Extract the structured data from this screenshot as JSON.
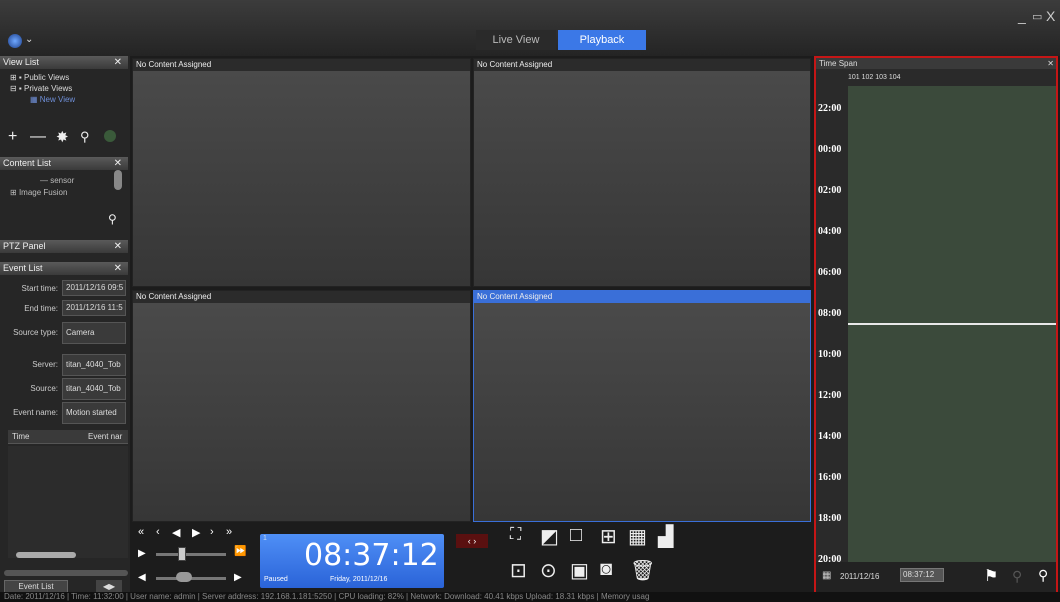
{
  "window": {
    "minimize": "_",
    "restore": "▭",
    "close": "X"
  },
  "tabs": {
    "live": "Live View",
    "playback": "Playback"
  },
  "view_list": {
    "title": "View List",
    "items": [
      "Public Views",
      "Private Views",
      "New View"
    ]
  },
  "content_list": {
    "title": "Content List",
    "items": [
      "sensor",
      "Image Fusion"
    ]
  },
  "ptz_panel": {
    "title": "PTZ Panel"
  },
  "event_list": {
    "title": "Event List",
    "start_label": "Start time:",
    "start_value": "2011/12/16 09:5",
    "end_label": "End time:",
    "end_value": "2011/12/16 11:5",
    "source_type_label": "Source type:",
    "source_type_value": "Camera",
    "server_label": "Server:",
    "server_value": "titan_4040_Tob",
    "source_label": "Source:",
    "source_value": "titan_4040_Tob",
    "event_name_label": "Event name:",
    "event_name_value": "Motion started",
    "col_time": "Time",
    "col_event": "Event nar",
    "footer": "Event List"
  },
  "panes": [
    "No Content Assigned",
    "No Content Assigned",
    "No Content Assigned",
    "No Content Assigned"
  ],
  "clock": {
    "time": "08:37:12",
    "date": "Friday, 2011/12/16",
    "state": "Paused",
    "channel": "1"
  },
  "time_span": {
    "title": "Time Span",
    "channels": "101 102 103 104",
    "times": [
      "22:00",
      "00:00",
      "02:00",
      "04:00",
      "06:00",
      "08:00",
      "10:00",
      "12:00",
      "14:00",
      "16:00",
      "18:00",
      "20:00"
    ],
    "date": "2011/12/16",
    "time": "08:37:12"
  },
  "status": "Date: 2011/12/16 | Time: 11:32:00 | User name: admin | Server address: 192.168.1.181:5250 | CPU loading: 82% | Network: Download: 40.41 kbps Upload: 18.31 kbps | Memory usag"
}
